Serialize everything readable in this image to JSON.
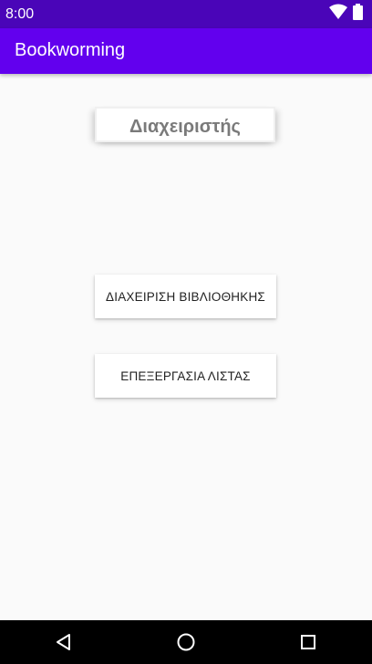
{
  "status_bar": {
    "time": "8:00",
    "icons": [
      "wifi-icon",
      "battery-icon"
    ]
  },
  "app_bar": {
    "title": "Bookworming",
    "color": "#6200ee"
  },
  "main": {
    "heading": "Διαχειριστής",
    "buttons": [
      {
        "label": "ΔΙΑΧΕΙΡΙΣΗ ΒΙΒΛΙΟΘΗΚΗΣ"
      },
      {
        "label": "ΕΠΕΞΕΡΓΑΣΙΑ ΛΙΣΤΑΣ"
      }
    ]
  },
  "nav_bar": {
    "icons": [
      "back-icon",
      "home-icon",
      "recents-icon"
    ]
  }
}
